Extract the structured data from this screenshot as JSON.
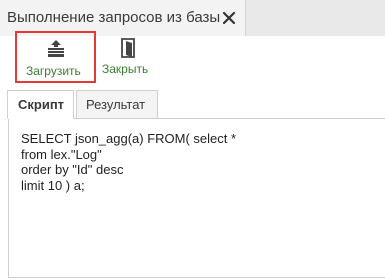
{
  "window": {
    "title": "Выполнение запросов из базы",
    "close_icon": "close-icon"
  },
  "toolbar": {
    "load_label": "Загрузить",
    "load_icon": "upload-tray-icon",
    "close_label": "Закрыть",
    "close_icon": "exit-door-icon",
    "label_color": "#3b7d2f",
    "highlight_color": "#e53935"
  },
  "tabs": [
    {
      "label": "Скрипт",
      "active": true
    },
    {
      "label": "Результат",
      "active": false
    }
  ],
  "editor": {
    "lines": [
      "SELECT json_agg(a) FROM( select *",
      "from lex.\"Log\"",
      "order by \"Id\" desc",
      "limit 10 ) a;"
    ]
  }
}
